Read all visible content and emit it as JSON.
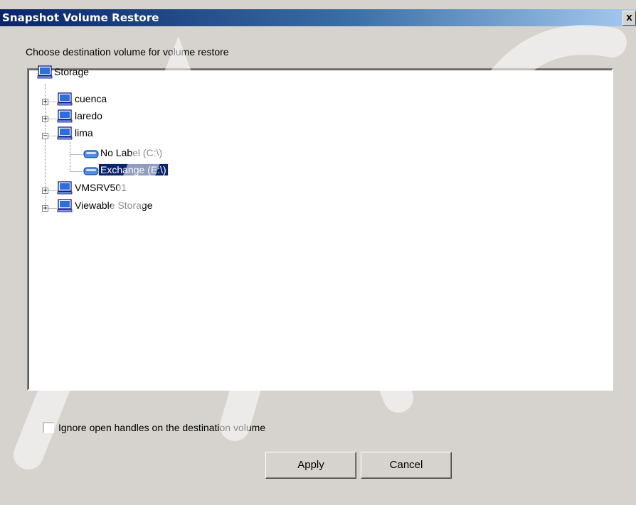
{
  "window": {
    "title": "Snapshot Volume Restore",
    "close_label": "x"
  },
  "prompt": "Choose destination volume for volume restore",
  "tree": {
    "root": {
      "label": "Storage",
      "icon": "computer-icon"
    },
    "nodes": [
      {
        "label": "cuenca",
        "expander": "+",
        "icon": "computer-icon"
      },
      {
        "label": "laredo",
        "expander": "+",
        "icon": "computer-icon"
      },
      {
        "label": "lima",
        "expander": "−",
        "icon": "computer-icon",
        "children": [
          {
            "label": "No Label (C:\\)",
            "icon": "drive-icon"
          },
          {
            "label": "Exchange (E:\\)",
            "icon": "drive-icon",
            "selected": true
          }
        ]
      },
      {
        "label": "VMSRV501",
        "expander": "+",
        "icon": "computer-icon"
      },
      {
        "label": "Viewable Storage",
        "expander": "+",
        "icon": "computer-icon"
      }
    ]
  },
  "options": {
    "ignore_handles_label": "Ignore open handles on the destination volume",
    "ignore_handles_checked": false
  },
  "buttons": {
    "apply": "Apply",
    "cancel": "Cancel"
  },
  "colors": {
    "title_gradient_start": "#0a246a",
    "title_gradient_end": "#a6caf0",
    "dialog_bg": "#d6d3ce",
    "selection_bg": "#0a246a"
  }
}
